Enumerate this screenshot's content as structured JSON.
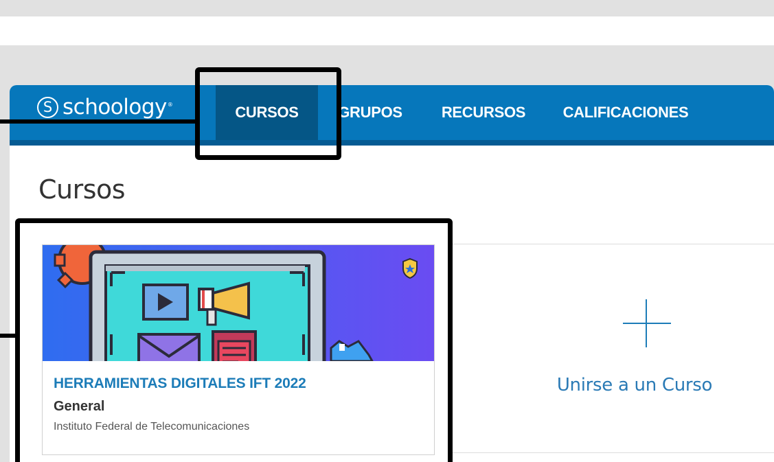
{
  "brand": {
    "name": "schoology",
    "mark": "S",
    "tm": "®"
  },
  "nav": {
    "items": [
      {
        "label": "CURSOS",
        "active": true
      },
      {
        "label": "GRUPOS",
        "active": false
      },
      {
        "label": "RECURSOS",
        "active": false
      },
      {
        "label": "CALIFICACIONES",
        "active": false
      }
    ]
  },
  "page": {
    "title": "Cursos"
  },
  "course_card": {
    "name": "HERRAMIENTAS DIGITALES IFT 2022",
    "section": "General",
    "school": "Instituto Federal de Telecomunicaciones",
    "image_icons": [
      "gear-icon",
      "laptop-icon",
      "video-play-icon",
      "megaphone-icon",
      "mail-icon",
      "document-icon",
      "badge-icon"
    ]
  },
  "join": {
    "label": "Unirse a un Curso",
    "icon": "plus-icon"
  },
  "colors": {
    "nav_blue": "#0677bb",
    "nav_active": "#055686",
    "link_blue": "#1c7cb8",
    "annotation": "#000000"
  }
}
